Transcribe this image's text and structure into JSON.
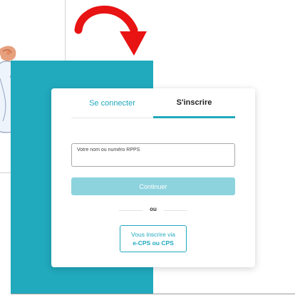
{
  "tabs": {
    "login_label": "Se connecter",
    "signup_label": "S'inscrire",
    "active": "signup"
  },
  "form": {
    "name_label": "Votre nom ou numéro RPPS",
    "name_value": "",
    "continue_label": "Continuer"
  },
  "separator": {
    "text": "ou"
  },
  "ecps": {
    "line1": "Vous inscrire via",
    "line2": "e-CPS ou CPS"
  },
  "colors": {
    "accent": "#21a9bd",
    "accent_light": "#8dd3de",
    "arrow": "#e81313"
  },
  "icons": [
    "curved-arrow-icon",
    "illustration-figure"
  ]
}
